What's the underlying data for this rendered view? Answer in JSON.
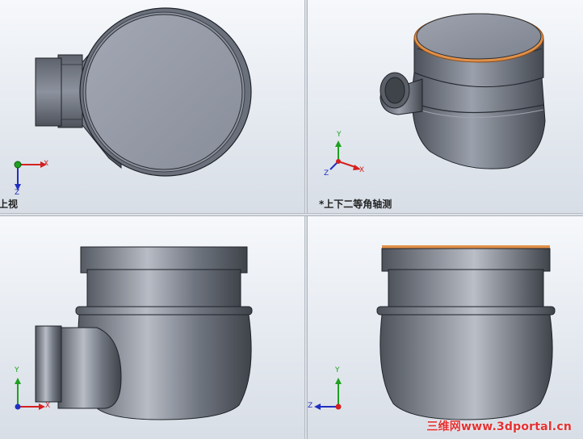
{
  "toolbar": {
    "icons": [
      "zoom-in-icon",
      "zoom-fit-icon",
      "rotate-icon",
      "section-view-icon",
      "view-orientation-icon",
      "display-style-icon",
      "appearance-icon",
      "scene-icon",
      "lighting-icon"
    ]
  },
  "viewports": {
    "top": {
      "label": "上视"
    },
    "iso": {
      "label": "*上下二等角轴测"
    },
    "front": {
      "label": ""
    },
    "right": {
      "label": ""
    }
  },
  "triad": {
    "x": "X",
    "y": "Y",
    "z": "Z"
  },
  "watermark": {
    "text": "三维网www.3dportal.cn"
  },
  "colors": {
    "body": "#6e7480",
    "rim_accent": "#e0904a",
    "axis_x": "#d42020",
    "axis_y": "#20a020",
    "axis_z": "#2030c0",
    "watermark": "#e53131"
  }
}
